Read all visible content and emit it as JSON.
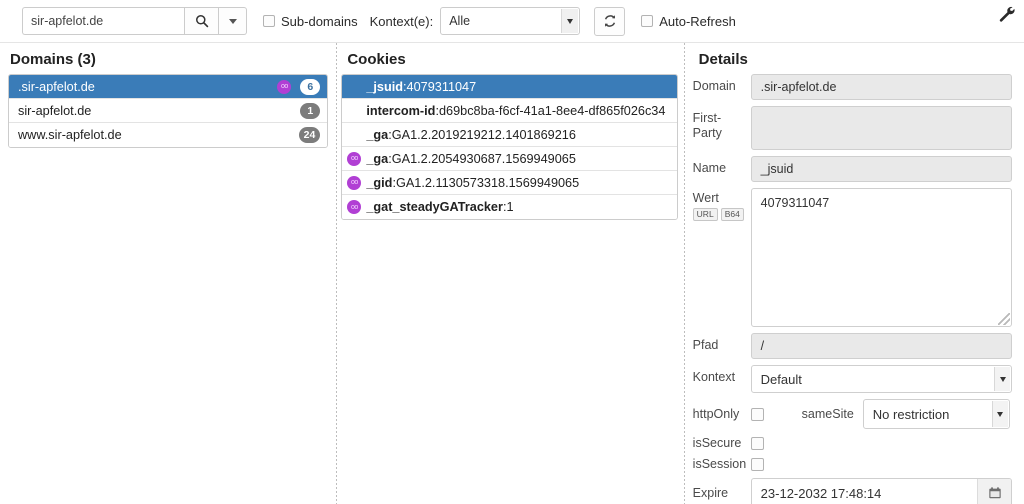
{
  "toolbar": {
    "search_value": "sir-apfelot.de",
    "search_placeholder": "",
    "search_icon": "search-icon",
    "dropdown_icon": "chevron-down-icon",
    "subdomains_label": "Sub-domains",
    "kontext_label": "Kontext(e):",
    "kontext_value": "Alle",
    "refresh_icon": "refresh-icon",
    "autorefresh_label": "Auto-Refresh",
    "wrench_icon": "wrench-icon"
  },
  "domains": {
    "title": "Domains (3)",
    "items": [
      {
        "label": ".sir-apfelot.de",
        "count": "6",
        "container_icon": "container-icon",
        "selected": true
      },
      {
        "label": "sir-apfelot.de",
        "count": "1",
        "container_icon": "",
        "selected": false
      },
      {
        "label": "www.sir-apfelot.de",
        "count": "24",
        "container_icon": "",
        "selected": false
      }
    ]
  },
  "cookies": {
    "title": "Cookies",
    "items": [
      {
        "name": "_jsuid",
        "value": "4079311047",
        "container_icon": "",
        "selected": true
      },
      {
        "name": "intercom-id",
        "value": "d69bc8ba-f6cf-41a1-8ee4-df865f026c34",
        "container_icon": "",
        "selected": false
      },
      {
        "name": "_ga",
        "value": "GA1.2.2019219212.1401869216",
        "container_icon": "",
        "selected": false
      },
      {
        "name": "_ga",
        "value": "GA1.2.2054930687.1569949065",
        "container_icon": "container-icon",
        "selected": false
      },
      {
        "name": "_gid",
        "value": "GA1.2.1130573318.1569949065",
        "container_icon": "container-icon",
        "selected": false
      },
      {
        "name": "_gat_steadyGATracker",
        "value": "1",
        "container_icon": "container-icon",
        "selected": false
      }
    ]
  },
  "details": {
    "title": "Details",
    "domain_label": "Domain",
    "domain_value": ".sir-apfelot.de",
    "firstparty_label": "First-Party",
    "firstparty_value": "",
    "name_label": "Name",
    "name_value": "_jsuid",
    "wert_label": "Wert",
    "wert_url_btn": "URL",
    "wert_b64_btn": "B64",
    "wert_value": "4079311047",
    "pfad_label": "Pfad",
    "pfad_value": "/",
    "kontext_label": "Kontext",
    "kontext_value": "Default",
    "httponly_label": "httpOnly",
    "samesite_label": "sameSite",
    "samesite_value": "No restriction",
    "issecure_label": "isSecure",
    "issession_label": "isSession",
    "expire_label": "Expire",
    "expire_value": "23-12-2032 17:48:14",
    "calendar_icon": "calendar-icon"
  },
  "colors": {
    "selection_blue": "#3a7cb8",
    "container_purple": "#b13fd4",
    "badge_gray": "#7c7c7c"
  }
}
